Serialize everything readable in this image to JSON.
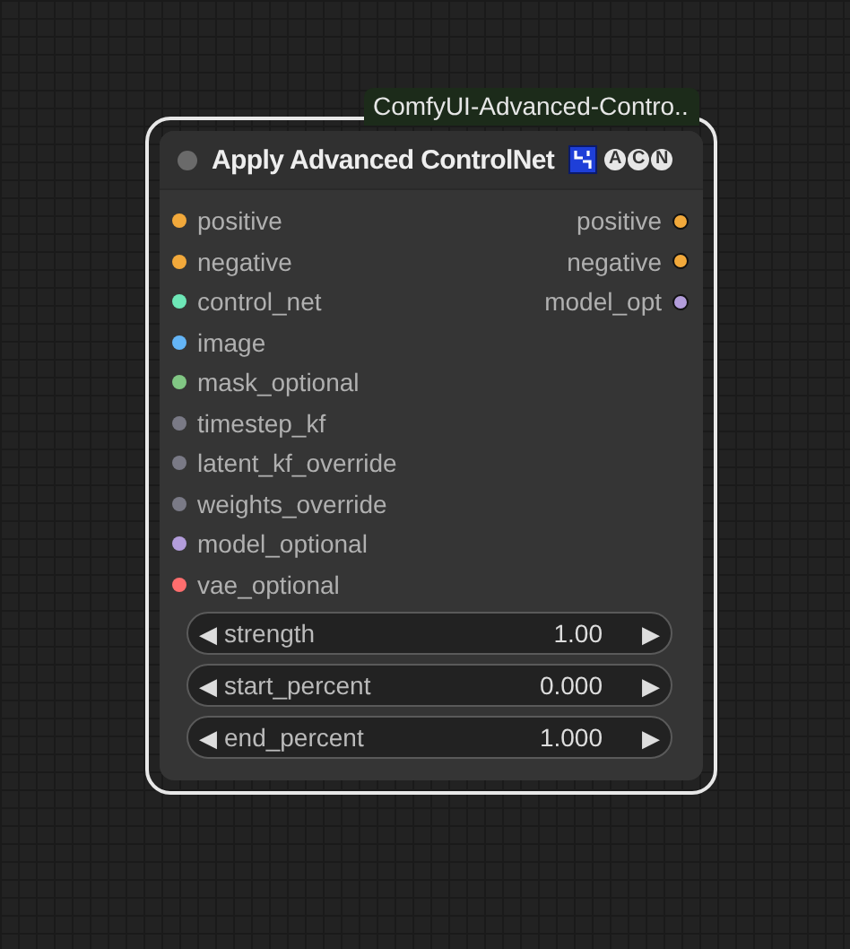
{
  "node": {
    "source_tag": "ComfyUI-Advanced-Contro..",
    "title": "Apply Advanced ControlNet",
    "selected": true,
    "badges": [
      {
        "kind": "icon"
      },
      {
        "kind": "letter",
        "text": "A"
      },
      {
        "kind": "letter",
        "text": "C"
      },
      {
        "kind": "letter",
        "text": "N"
      }
    ],
    "inputs": [
      {
        "label": "positive",
        "color": "#f2a93b"
      },
      {
        "label": "negative",
        "color": "#f2a93b"
      },
      {
        "label": "control_net",
        "color": "#6ee7b7"
      },
      {
        "label": "image",
        "color": "#64b5f6"
      },
      {
        "label": "mask_optional",
        "color": "#81c784"
      },
      {
        "label": "timestep_kf",
        "color": "#7a7a86"
      },
      {
        "label": "latent_kf_override",
        "color": "#7a7a86"
      },
      {
        "label": "weights_override",
        "color": "#7a7a86"
      },
      {
        "label": "model_optional",
        "color": "#b39ddb"
      },
      {
        "label": "vae_optional",
        "color": "#ff6e6e"
      }
    ],
    "outputs": [
      {
        "label": "positive",
        "color": "#f2a93b"
      },
      {
        "label": "negative",
        "color": "#f2a93b"
      },
      {
        "label": "model_opt",
        "color": "#b39ddb"
      }
    ],
    "widgets": [
      {
        "label": "strength",
        "value": "1.00",
        "left_arrow": "◀",
        "right_arrow": "▶"
      },
      {
        "label": "start_percent",
        "value": "0.000",
        "left_arrow": "◀",
        "right_arrow": "▶"
      },
      {
        "label": "end_percent",
        "value": "1.000",
        "left_arrow": "◀",
        "right_arrow": "▶"
      }
    ]
  }
}
